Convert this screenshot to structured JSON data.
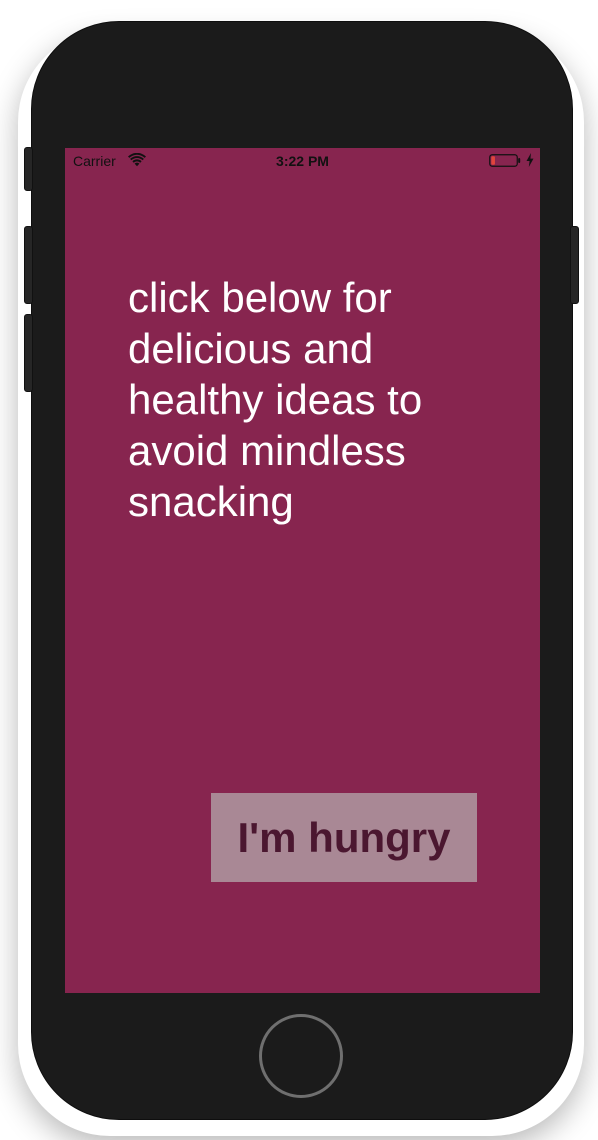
{
  "status_bar": {
    "carrier": "Carrier",
    "time": "3:22 PM",
    "wifi_icon": "wifi-icon",
    "battery_icon": "battery-low-icon",
    "charging_icon": "charging-bolt-icon",
    "battery_level_fraction": 0.15
  },
  "main": {
    "headline": "click below for delicious and healthy ideas to avoid mindless snacking",
    "button_label": "I'm hungry"
  },
  "device": {
    "home_button_icon": "home-button"
  },
  "colors": {
    "screen_background": "#87254f",
    "headline_text": "#ffffff",
    "button_background": "#a98895",
    "button_text": "#4b1730",
    "battery_low": "#e0453c"
  }
}
